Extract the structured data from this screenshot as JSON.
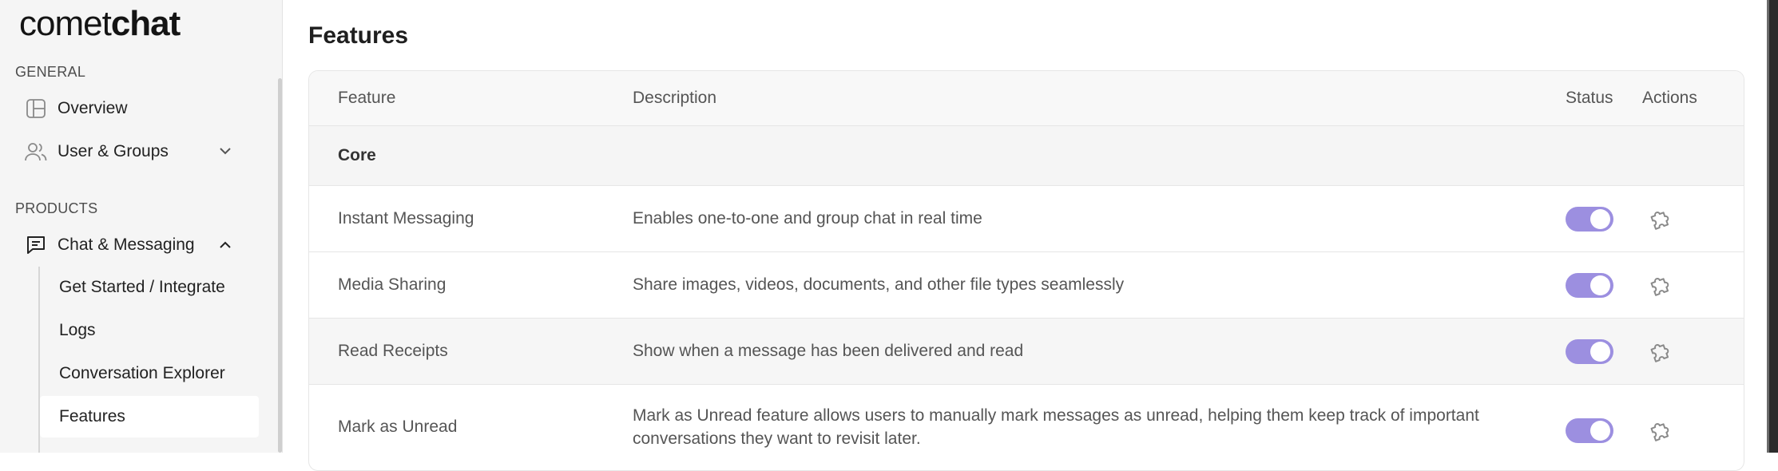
{
  "logo": {
    "light": "comet",
    "bold": "chat"
  },
  "sidebar": {
    "general_label": "GENERAL",
    "general_items": [
      {
        "label": "Overview",
        "icon": "layout-icon"
      },
      {
        "label": "User & Groups",
        "icon": "users-icon",
        "chevron": "chevron-down-icon"
      }
    ],
    "products_label": "PRODUCTS",
    "product_item": {
      "label": "Chat & Messaging",
      "icon": "chat-icon",
      "chevron": "chevron-up-icon"
    },
    "sub_items": [
      {
        "label": "Get Started / Integrate"
      },
      {
        "label": "Logs"
      },
      {
        "label": "Conversation Explorer"
      },
      {
        "label": "Features",
        "active": true
      }
    ]
  },
  "main": {
    "title": "Features",
    "columns": [
      "Feature",
      "Description",
      "Status",
      "Actions"
    ],
    "group": "Core",
    "rows": [
      {
        "feature": "Instant Messaging",
        "description": [
          "Enables one-to-one and group chat in real time"
        ],
        "enabled": true
      },
      {
        "feature": "Media Sharing",
        "description": [
          "Share images, videos, documents, and other file types seamlessly"
        ],
        "enabled": true
      },
      {
        "feature": "Read Receipts",
        "description": [
          "Show when a message has been delivered and read"
        ],
        "enabled": true
      },
      {
        "feature": "Mark as Unread",
        "description": [
          "Mark as Unread feature allows users to manually mark messages as unread, helping them keep track of important",
          "conversations they want to revisit later."
        ],
        "enabled": true
      }
    ]
  },
  "colors": {
    "toggle_on": "#9c8fe0",
    "sidebar_bg": "#f5f5f5",
    "active_item_bg": "#ffffff"
  }
}
